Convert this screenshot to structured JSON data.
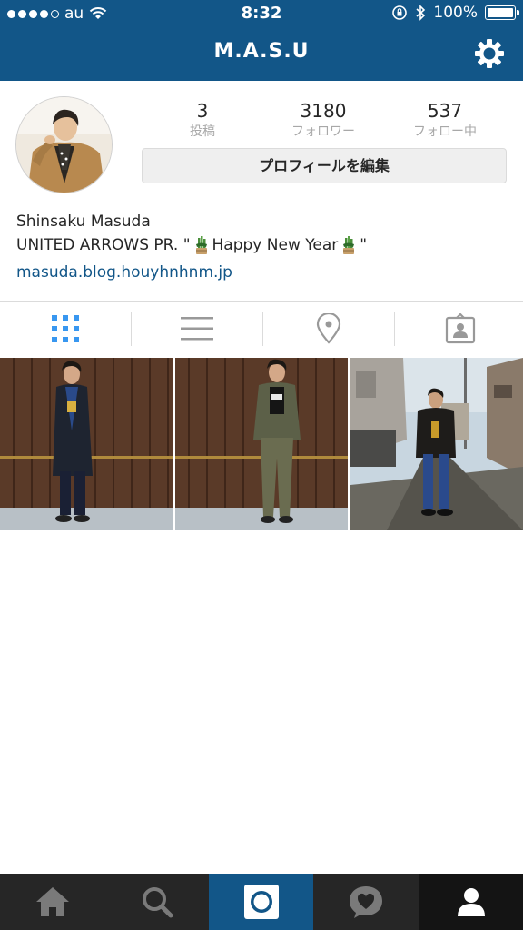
{
  "status_bar": {
    "carrier": "au",
    "time": "8:32",
    "battery": "100%",
    "battery_level": 1.0,
    "signal_bars_filled": 4,
    "signal_bars_total": 5
  },
  "header": {
    "title": "M.A.S.U",
    "settings_icon": "gear-icon",
    "background_color": "#125688"
  },
  "profile": {
    "posts_count": "3",
    "posts_label": "投稿",
    "followers_count": "3180",
    "followers_label": "フォロワー",
    "following_count": "537",
    "following_label": "フォロー中",
    "edit_button_label": "プロフィールを編集",
    "name": "Shinsaku Masuda",
    "bio_before": "UNITED ARROWS PR. \"",
    "bio_middle": "Happy New Year",
    "bio_after": "\"",
    "link": "masuda.blog.houyhnhnm.jp"
  },
  "view_tabs": [
    {
      "icon": "grid-icon",
      "active": true
    },
    {
      "icon": "list-icon",
      "active": false
    },
    {
      "icon": "location-pin-icon",
      "active": false
    },
    {
      "icon": "tagged-icon",
      "active": false
    }
  ],
  "posts": [
    {
      "icon": "photo-thumbnail"
    },
    {
      "icon": "photo-thumbnail"
    },
    {
      "icon": "photo-thumbnail"
    }
  ],
  "bottom_nav": [
    {
      "icon": "home-icon"
    },
    {
      "icon": "search-icon"
    },
    {
      "icon": "camera-icon",
      "active": true
    },
    {
      "icon": "activity-heart-icon"
    },
    {
      "icon": "profile-icon",
      "selected": true
    }
  ],
  "colors": {
    "brand": "#125688",
    "active_tab": "#3897f0",
    "inactive_icon": "#999999",
    "link": "#125688"
  }
}
